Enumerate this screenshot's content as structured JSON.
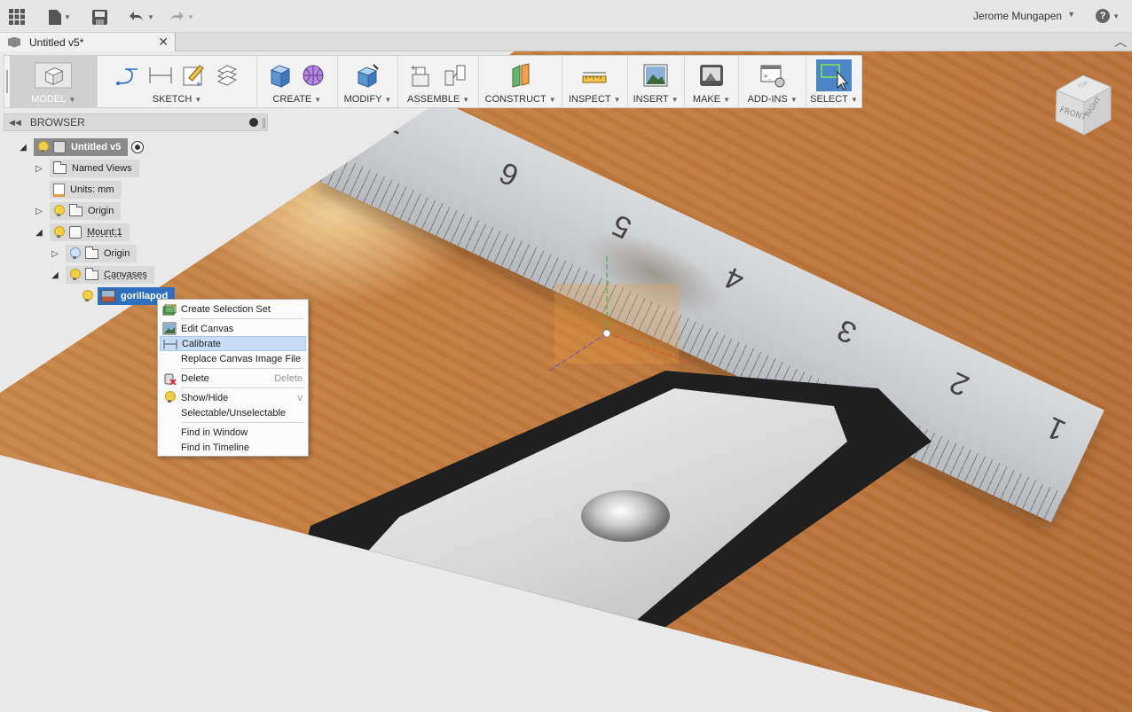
{
  "app": {
    "user_name": "Jerome Mungapen",
    "help_label": "?"
  },
  "tab": {
    "title": "Untitled v5*",
    "close": "✕"
  },
  "toolbar": {
    "groups": [
      {
        "id": "model",
        "label": "MODEL"
      },
      {
        "id": "sketch",
        "label": "SKETCH"
      },
      {
        "id": "create",
        "label": "CREATE"
      },
      {
        "id": "modify",
        "label": "MODIFY"
      },
      {
        "id": "assemble",
        "label": "ASSEMBLE"
      },
      {
        "id": "construct",
        "label": "CONSTRUCT"
      },
      {
        "id": "inspect",
        "label": "INSPECT"
      },
      {
        "id": "insert",
        "label": "INSERT"
      },
      {
        "id": "make",
        "label": "MAKE"
      },
      {
        "id": "addins",
        "label": "ADD-INS"
      },
      {
        "id": "select",
        "label": "SELECT"
      }
    ]
  },
  "browser": {
    "title": "BROWSER",
    "nodes": {
      "root": "Untitled v5",
      "named_views": "Named Views",
      "units": "Units: mm",
      "origin": "Origin",
      "mount": "Mount:1",
      "mount_origin": "Origin",
      "canvases": "Canvases",
      "gorillapod": "gorillapod"
    }
  },
  "viewcube": {
    "top": "TOP",
    "front": "FRONT",
    "right": "RIGHT"
  },
  "ruler_numbers": [
    "7",
    "6",
    "5",
    "4",
    "3",
    "2",
    "1"
  ],
  "context_menu": {
    "items": [
      {
        "label": "Create Selection Set",
        "shortcut": ""
      },
      {
        "label": "Edit Canvas",
        "shortcut": ""
      },
      {
        "label": "Calibrate",
        "shortcut": ""
      },
      {
        "label": "Replace Canvas Image File",
        "shortcut": ""
      },
      {
        "label": "Delete",
        "shortcut": "Delete"
      },
      {
        "label": "Show/Hide",
        "shortcut": "v"
      },
      {
        "label": "Selectable/Unselectable",
        "shortcut": ""
      },
      {
        "label": "Find in Window",
        "shortcut": ""
      },
      {
        "label": "Find in Timeline",
        "shortcut": ""
      }
    ],
    "highlighted": "Calibrate"
  },
  "colors": {
    "accent": "#2f6fbf",
    "menu_highlight": "#c7ddf6",
    "toolbar_bg": "#f3f3f3",
    "x_axis": "#e04b3a",
    "y_axis": "#3bb54a",
    "z_axis": "#7b4fc9"
  }
}
